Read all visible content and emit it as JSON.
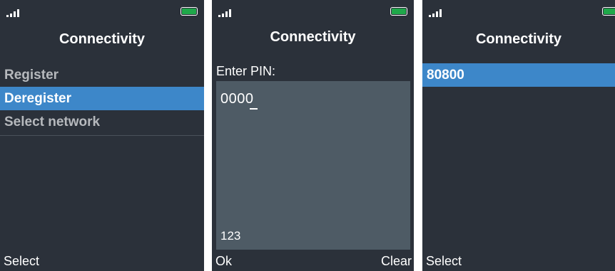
{
  "screens": [
    {
      "title": "Connectivity",
      "menu_items": [
        {
          "label": "Register",
          "selected": false
        },
        {
          "label": "Deregister",
          "selected": true
        },
        {
          "label": "Select network",
          "selected": false
        }
      ],
      "softkey_left": "Select"
    },
    {
      "title": "Connectivity",
      "prompt": "Enter PIN:",
      "pin_value": "0000",
      "input_mode": "123",
      "softkey_left": "Ok",
      "softkey_right": "Clear"
    },
    {
      "title": "Connectivity",
      "menu_items": [
        {
          "label": "80800",
          "selected": true
        }
      ],
      "softkey_left": "Select"
    }
  ],
  "colors": {
    "background": "#2b313a",
    "selection": "#3d87c9",
    "input_box": "#4e5b65",
    "battery_fill": "#1fa84a",
    "unselected_text": "#b6b9bd"
  },
  "icons": {
    "signal": "signal-strength-icon",
    "battery": "battery-icon"
  }
}
